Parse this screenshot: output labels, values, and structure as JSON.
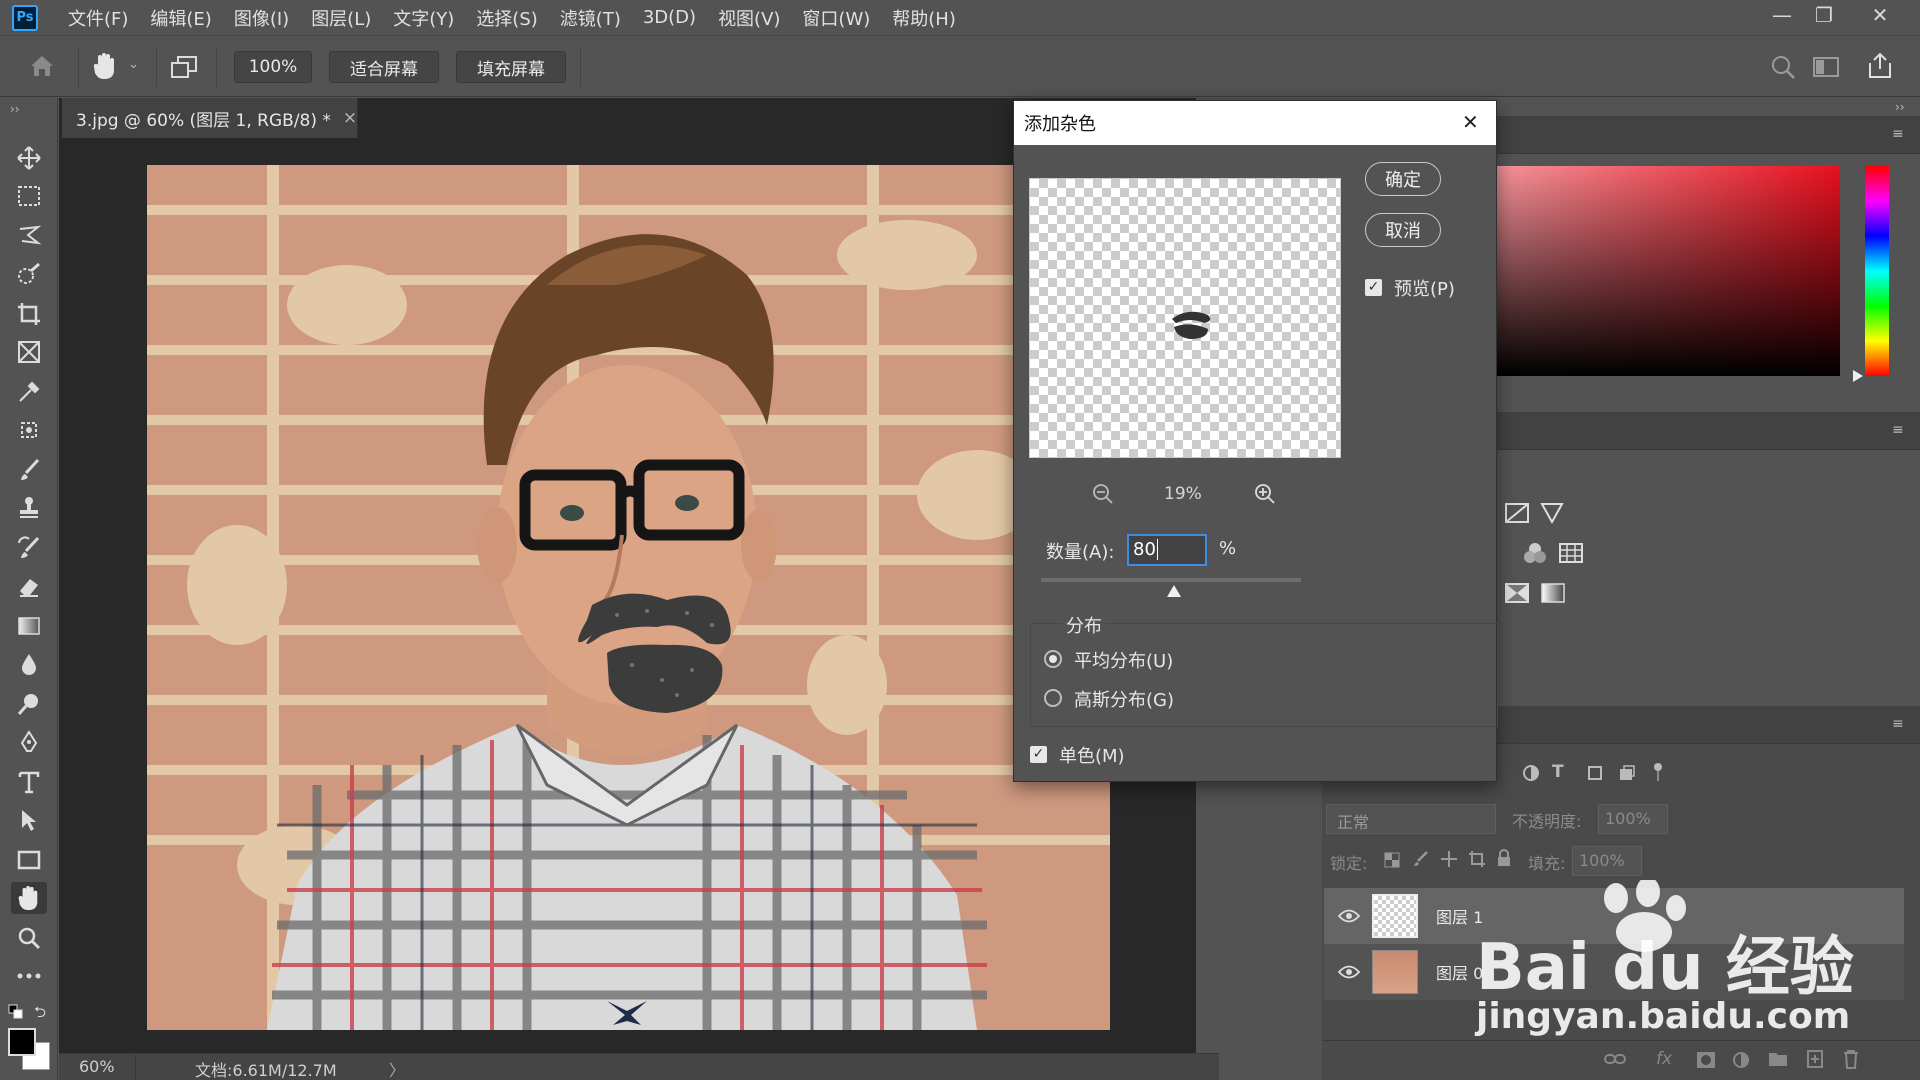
{
  "app": {
    "logo_text": "Ps",
    "menu": [
      "文件(F)",
      "编辑(E)",
      "图像(I)",
      "图层(L)",
      "文字(Y)",
      "选择(S)",
      "滤镜(T)",
      "3D(D)",
      "视图(V)",
      "窗口(W)",
      "帮助(H)"
    ],
    "window_controls": {
      "minimize": "—",
      "restore": "❐",
      "close": "✕"
    }
  },
  "options_bar": {
    "zoom_value": "100%",
    "fit_screen_label": "适合屏幕",
    "fill_screen_label": "填充屏幕"
  },
  "document": {
    "tab_title": "3.jpg @ 60% (图层 1, RGB/8) *",
    "tab_close": "×",
    "status_zoom": "60%",
    "status_doc": "文档:6.61M/12.7M",
    "status_arrow": "〉"
  },
  "dialog": {
    "title": "添加杂色",
    "close": "✕",
    "ok_label": "确定",
    "cancel_label": "取消",
    "preview_label": "预览(P)",
    "preview_checked": true,
    "preview_zoom": "19%",
    "amount_label": "数量(A):",
    "amount_value": "80",
    "amount_unit": "%",
    "amount_slider_fraction": 0.51,
    "distribution_label": "分布",
    "uniform_label": "平均分布(U)",
    "gaussian_label": "高斯分布(G)",
    "selected_distribution": "uniform",
    "monochrome_label": "单色(M)",
    "monochrome_checked": true
  },
  "layers_panel": {
    "blend_mode": "正常",
    "opacity_label": "不透明度:",
    "opacity_value": "100%",
    "lock_label": "锁定:",
    "fill_label": "填充:",
    "fill_value": "100%",
    "layers": [
      {
        "name": "图层 1",
        "selected": true
      },
      {
        "name": "图层 0",
        "selected": false
      }
    ],
    "footer_fx": "fx"
  },
  "watermark": {
    "brand_line": "Bai du 经验",
    "url_line": "jingyan.baidu.com"
  },
  "colors": {
    "ui_bg": "#535353",
    "panel_dark": "#424242",
    "canvas_bg": "#282828",
    "ps_blue": "#31a8ff",
    "ps_navy": "#001e36"
  }
}
